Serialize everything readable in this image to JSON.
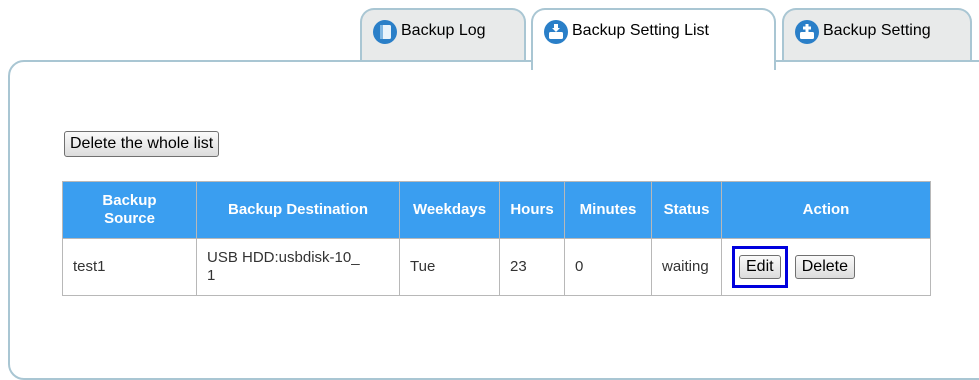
{
  "tabs": [
    {
      "label": "Backup Log",
      "icon": "book-icon",
      "active": false
    },
    {
      "label": "Backup Setting List",
      "icon": "backup-list-icon",
      "active": true
    },
    {
      "label": "Backup Setting",
      "icon": "backup-add-icon",
      "active": false
    }
  ],
  "delete_all_label": "Delete the whole list",
  "table": {
    "headers": {
      "source": "Backup Source",
      "destination": "Backup Destination",
      "weekdays": "Weekdays",
      "hours": "Hours",
      "minutes": "Minutes",
      "status": "Status",
      "action": "Action"
    },
    "rows": [
      {
        "source": "test1",
        "destination": "USB HDD:usbdisk-10_1",
        "weekdays": "Tue",
        "hours": "23",
        "minutes": "0",
        "status": "waiting",
        "edit_label": "Edit",
        "delete_label": "Delete"
      }
    ]
  },
  "colors": {
    "header_bg": "#3a9ef0",
    "tab_border": "#a9c6d3",
    "highlight_border": "#0000dd"
  }
}
